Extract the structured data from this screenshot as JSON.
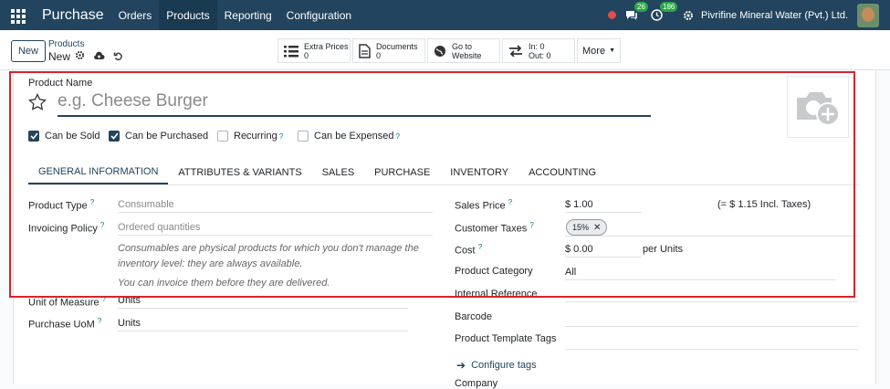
{
  "nav": {
    "app_name": "Purchase",
    "menu": [
      "Orders",
      "Products",
      "Reporting",
      "Configuration"
    ],
    "active_menu": "Products",
    "messages_count": "26",
    "activity_count": "186",
    "company": "Pivrifine Mineral Water (Pvt.) Ltd."
  },
  "control": {
    "new_label": "New",
    "breadcrumb_parent": "Products",
    "breadcrumb_current": "New",
    "smart_buttons": [
      {
        "label": "Extra Prices",
        "value": "0"
      },
      {
        "label": "Documents",
        "value": "0"
      },
      {
        "label": "Go to",
        "value": "Website"
      },
      {
        "label": "In: 0",
        "value": "Out: 0"
      }
    ],
    "more_label": "More"
  },
  "form": {
    "product_name_label": "Product Name",
    "product_name_placeholder": "e.g. Cheese Burger",
    "checkboxes": [
      {
        "label": "Can be Sold",
        "checked": true
      },
      {
        "label": "Can be Purchased",
        "checked": true
      },
      {
        "label": "Recurring",
        "checked": false
      },
      {
        "label": "Can be Expensed",
        "checked": false
      }
    ],
    "tabs": [
      "GENERAL INFORMATION",
      "ATTRIBUTES & VARIANTS",
      "SALES",
      "PURCHASE",
      "INVENTORY",
      "ACCOUNTING"
    ],
    "active_tab": "GENERAL INFORMATION",
    "left": {
      "product_type_label": "Product Type",
      "product_type_value": "Consumable",
      "invoicing_policy_label": "Invoicing Policy",
      "invoicing_policy_value": "Ordered quantities",
      "help1": "Consumables are physical products for which you don't manage the inventory level: they are always available.",
      "help2": "You can invoice them before they are delivered.",
      "uom_label": "Unit of Measure",
      "uom_value": "Units",
      "purchase_uom_label": "Purchase UoM",
      "purchase_uom_value": "Units"
    },
    "right": {
      "sales_price_label": "Sales Price",
      "sales_price_value": "$ 1.00",
      "incl_taxes": "(= $ 1.15 Incl. Taxes)",
      "customer_taxes_label": "Customer Taxes",
      "tax_tag": "15%",
      "cost_label": "Cost",
      "cost_value": "$ 0.00",
      "cost_unit": "per Units",
      "category_label": "Product Category",
      "category_value": "All",
      "internal_ref_label": "Internal Reference",
      "barcode_label": "Barcode",
      "template_tags_label": "Product Template Tags",
      "configure_tags": "Configure tags",
      "company_label": "Company"
    }
  },
  "colors": {
    "nav_bg": "#22445e",
    "accent": "#22445e",
    "highlight_box": "#d9222a"
  }
}
